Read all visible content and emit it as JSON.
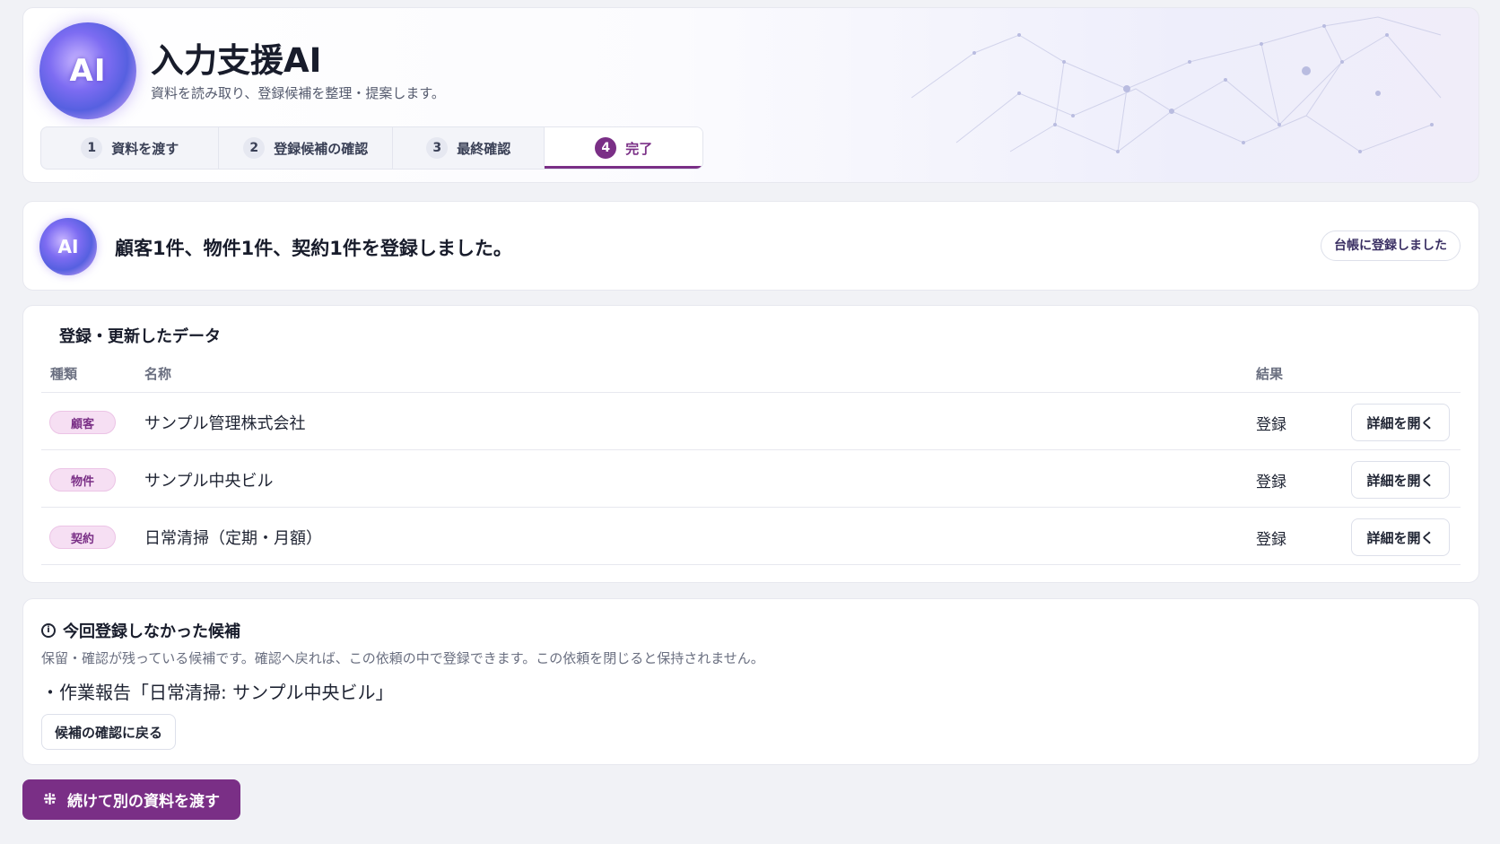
{
  "app": {
    "title": "入力支援AI",
    "subtitle": "資料を読み取り、登録候補を整理・提案します。",
    "logo_text": "AI"
  },
  "steps": [
    {
      "num": "1",
      "label": "資料を渡す"
    },
    {
      "num": "2",
      "label": "登録候補の確認"
    },
    {
      "num": "3",
      "label": "最終確認"
    },
    {
      "num": "4",
      "label": "完了",
      "active": true
    }
  ],
  "summary": {
    "message": "顧客1件、物件1件、契約1件を登録しました。",
    "badge": "台帳に登録しました"
  },
  "data_table": {
    "title": "登録・更新したデータ",
    "columns": {
      "kind": "種類",
      "name": "名称",
      "result": "結果"
    },
    "rows": [
      {
        "kind": "顧客",
        "name": "サンプル管理株式会社",
        "result": "登録",
        "action": "詳細を開く"
      },
      {
        "kind": "物件",
        "name": "サンプル中央ビル",
        "result": "登録",
        "action": "詳細を開く"
      },
      {
        "kind": "契約",
        "name": "日常清掃（定期・月額）",
        "result": "登録",
        "action": "詳細を開く"
      }
    ]
  },
  "pending": {
    "title": "今回登録しなかった候補",
    "description": "保留・確認が残っている候補です。確認へ戻れば、この依頼の中で登録できます。この依頼を閉じると保持されません。",
    "item": "・作業報告「日常清掃: サンプル中央ビル」",
    "back_button": "候補の確認に戻る"
  },
  "continue_button": "続けて別の資料を渡す",
  "colors": {
    "accent": "#7a2f86",
    "tag_bg": "#f6dff3"
  },
  "icons": {
    "info": "info-icon",
    "spark": "spark-icon"
  }
}
